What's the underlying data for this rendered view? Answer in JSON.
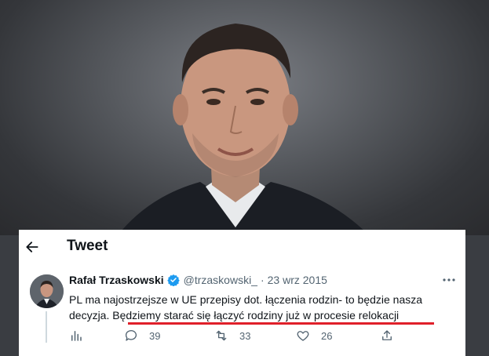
{
  "header": {
    "title": "Tweet"
  },
  "tweet": {
    "author_name": "Rafał Trzaskowski",
    "handle": "@trzaskowski_",
    "separator": "·",
    "date": "23 wrz 2015",
    "text_part1": "PL ma najostrzejsze w UE przepisy dot. łączenia rodzin- to będzie nasza decyzja. ",
    "text_part2": "Będziemy starać się łączyć rodziny już w procesie relokacji",
    "replies": "39",
    "retweets": "33",
    "likes": "26"
  },
  "colors": {
    "highlight_underline": "#e0202a",
    "verified": "#1d9bf0",
    "muted_text": "#536471"
  },
  "icons": [
    "back-arrow-icon",
    "verified-badge-icon",
    "more-icon",
    "analytics-icon",
    "reply-icon",
    "retweet-icon",
    "like-icon",
    "share-icon"
  ]
}
